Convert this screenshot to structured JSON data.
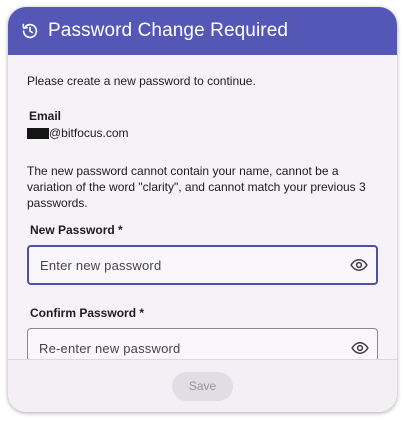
{
  "dialog": {
    "title": "Password Change Required",
    "header_icon": "history-icon",
    "header_color": "#5457b5"
  },
  "intro": "Please create a new password to continue.",
  "email": {
    "label": "Email",
    "value_suffix": "@bitfocus.com"
  },
  "rules": "The new password cannot contain your name, cannot be a variation of the word \"clarity\", and cannot match your previous 3 passwords.",
  "new_password": {
    "label": "New Password *",
    "placeholder": "Enter new password",
    "icon": "eye-icon"
  },
  "confirm_password": {
    "label": "Confirm Password *",
    "placeholder": "Re-enter new password",
    "icon": "eye-icon"
  },
  "footer": {
    "save_label": "Save",
    "save_enabled": false
  }
}
